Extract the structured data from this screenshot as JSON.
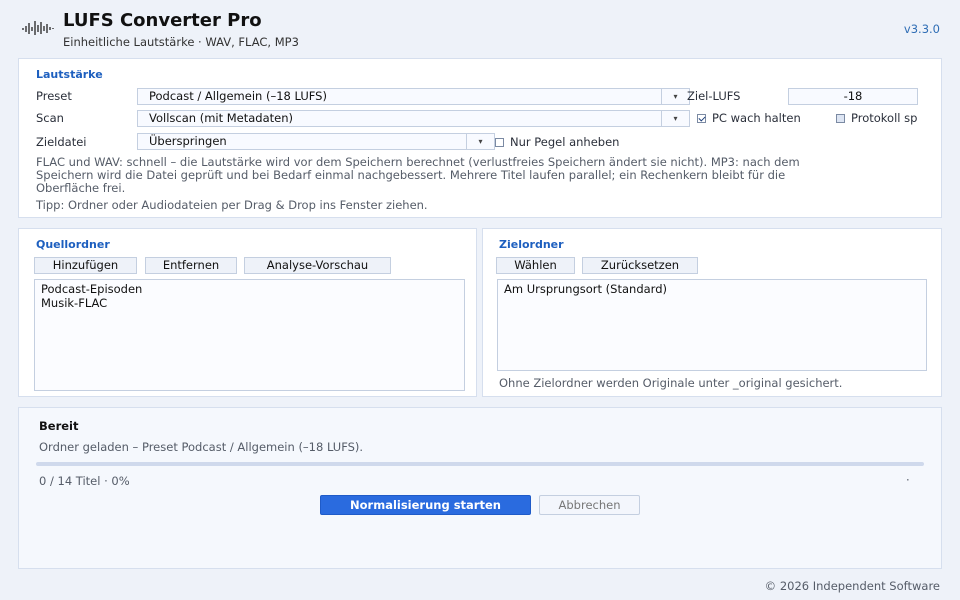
{
  "app": {
    "title": "LUFS Converter Pro",
    "subtitle": "Einheitliche Lautstärke · WAV, FLAC, MP3",
    "version": "v3.3.0",
    "logo_icon": "waveform-icon"
  },
  "loudness": {
    "section_title": "Lautstärke",
    "preset_label": "Preset",
    "preset_value": "Podcast / Allgemein (–18 LUFS)",
    "target_lufs_label": "Ziel-LUFS",
    "target_lufs_value": "-18",
    "scan_label": "Scan",
    "scan_value": "Vollscan (mit Metadaten)",
    "keep_awake_label": "PC wach halten",
    "keep_awake_checked": true,
    "log_label": "Protokoll sp",
    "target_file_label": "Zieldatei",
    "target_file_value": "Überspringen",
    "only_raise_label": "Nur Pegel anheben",
    "only_raise_checked": false,
    "info_line1": "FLAC und WAV: schnell – die Lautstärke wird vor dem Speichern berechnet (verlustfreies Speichern ändert sie nicht). MP3: nach dem",
    "info_line2": "Speichern wird die Datei geprüft und bei Bedarf einmal nachgebessert. Mehrere Titel laufen parallel; ein Rechenkern bleibt für die",
    "info_line3": "Oberfläche frei.",
    "tip": "Tipp: Ordner oder Audiodateien per Drag & Drop ins Fenster ziehen."
  },
  "source": {
    "section_title": "Quellordner",
    "add_label": "Hinzufügen",
    "remove_label": "Entfernen",
    "preview_label": "Analyse-Vorschau",
    "items": [
      "Podcast-Episoden",
      "Musik-FLAC"
    ]
  },
  "target": {
    "section_title": "Zielordner",
    "choose_label": "Wählen",
    "reset_label": "Zurücksetzen",
    "items": [
      "Am Ursprungsort (Standard)"
    ],
    "note": "Ohne Zielordner werden Originale unter _original gesichert."
  },
  "status": {
    "title": "Bereit",
    "message": "Ordner geladen – Preset Podcast / Allgemein (–18 LUFS).",
    "progress_fraction": 0,
    "progress_text": "0 / 14 Titel · 0%",
    "right_text": "·",
    "start_label": "Normalisierung starten",
    "cancel_label": "Abbrechen"
  },
  "footer": {
    "copyright": "© 2026 Independent Software"
  },
  "colors": {
    "accent": "#1d5fbf",
    "primary_button": "#2a6bdf",
    "background": "#eef2f9"
  }
}
